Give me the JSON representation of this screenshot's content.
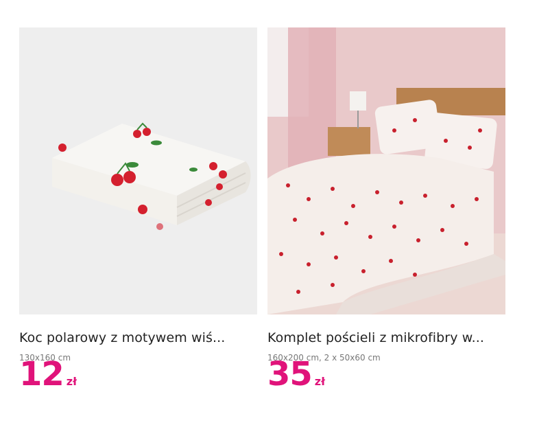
{
  "products": [
    {
      "title": "Koc polarowy z motywem wiś...",
      "dimensions": "130x160 cm",
      "price": "12",
      "currency": "zł",
      "image_icon": "blanket-image"
    },
    {
      "title": "Komplet pościeli z mikrofibry w...",
      "dimensions": "160x200 cm, 2 x 50x60 cm",
      "price": "35",
      "currency": "zł",
      "image_icon": "bedding-image"
    }
  ],
  "colors": {
    "price": "#e0137a",
    "image_bg_1": "#eeeeee",
    "image_bg_2": "#e9c9ca",
    "cherry": "#d4202e",
    "leaf": "#3b8a3a"
  }
}
